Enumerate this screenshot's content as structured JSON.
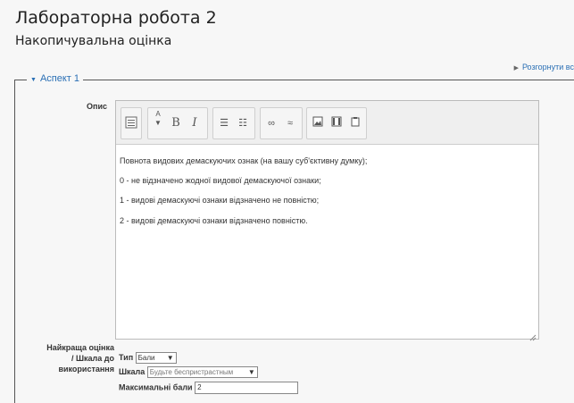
{
  "page": {
    "title": "Лабораторна робота 2",
    "subtitle": "Накопичувальна оцінка",
    "expand_all": "Розгорнути вс"
  },
  "aspect": {
    "legend": "Аспект 1",
    "description_label": "Опис",
    "editor_lines": [
      "Повнота видових демаскуючих ознак (на вашу суб'єктивну думку);",
      "0 - не відзначено жодної видової демаскуючої ознаки;",
      "1 -  видові демаскуючі ознаки відзначено не повністю;",
      "2 - видові демаскуючі ознаки відзначено повністю."
    ],
    "best_grade_label": "Найкраща оцінка / Шкала до використання",
    "type_label": "Тип",
    "type_value": "Бали",
    "scale_label": "Шкала",
    "scale_value": "Будьте беспристрастным",
    "max_points_label": "Максимальні бали",
    "max_points_value": "2"
  },
  "colors": {
    "link": "#2a6fb5",
    "line": "#555555"
  },
  "icons": [
    "toggle-toolbar-icon",
    "font-size-icon",
    "bold-icon",
    "italic-icon",
    "unordered-list-icon",
    "ordered-list-icon",
    "link-icon",
    "unlink-icon",
    "image-icon",
    "media-icon",
    "paste-icon",
    "resize-handle-icon"
  ]
}
